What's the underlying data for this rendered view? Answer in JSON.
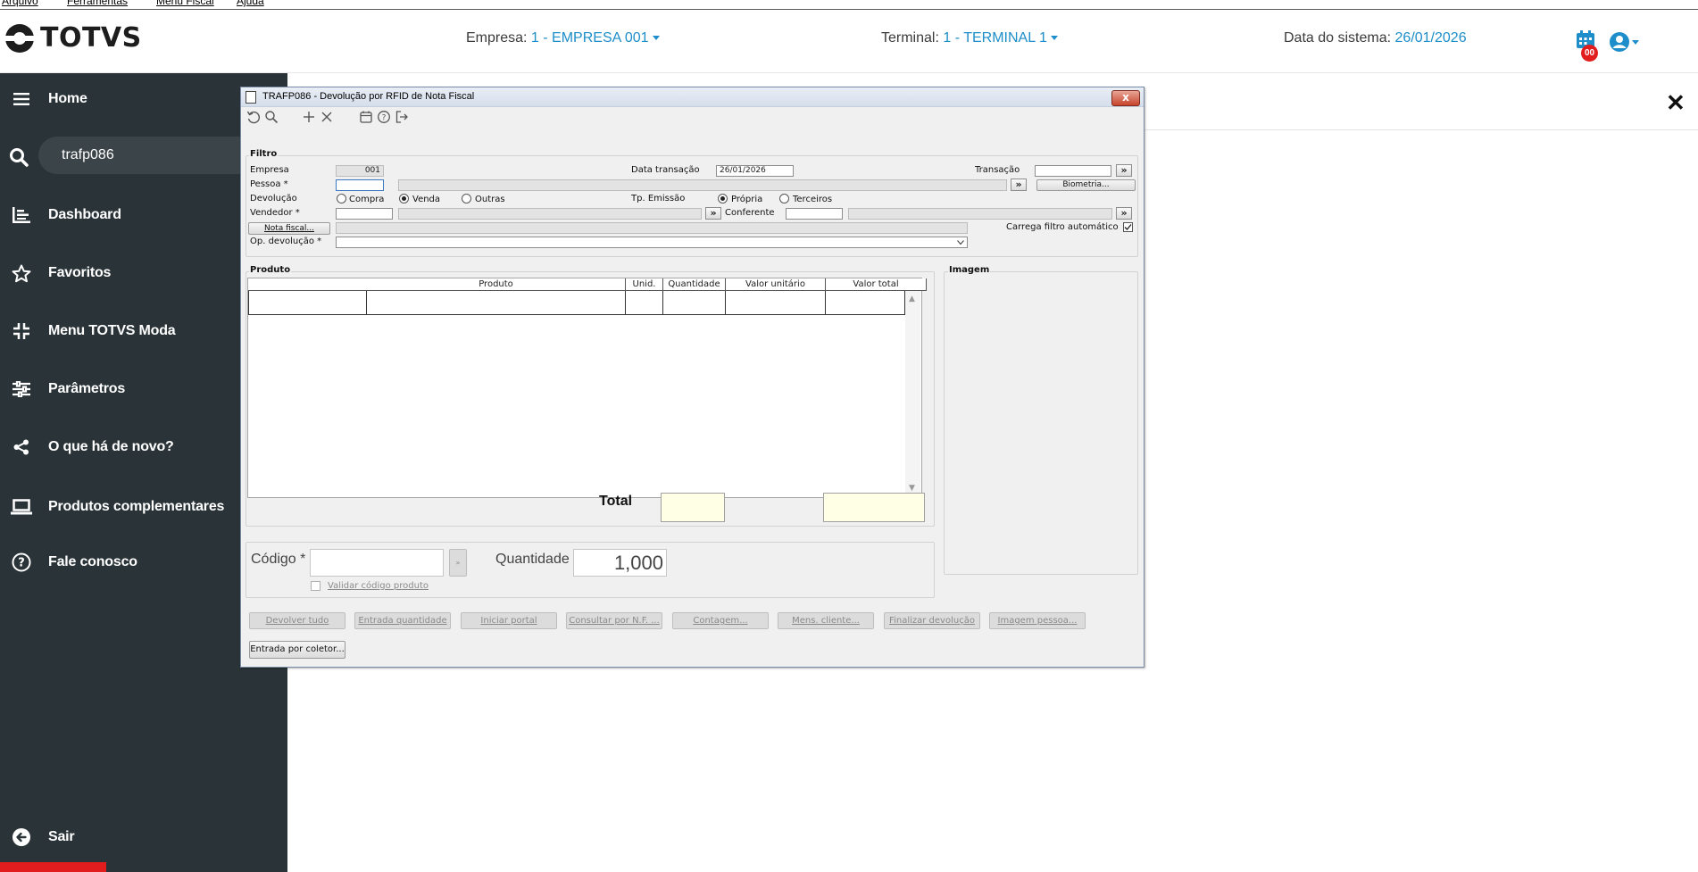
{
  "menubar": [
    "Arquivo",
    "Ferramentas",
    "Menu Fiscal",
    "Ajuda"
  ],
  "header": {
    "logo_text": "TOTVS",
    "empresa_label": "Empresa:",
    "empresa_value": "1 - EMPRESA 001",
    "terminal_label": "Terminal:",
    "terminal_value": "1 - TERMINAL 1",
    "data_label": "Data do sistema:",
    "data_value": "26/01/2026",
    "badge_count": "00",
    "accent": "#1d8ec9"
  },
  "sidebar": {
    "search_value": "trafp086",
    "items": [
      {
        "label": "Home",
        "icon": "menu-icon"
      },
      {
        "label": "Dashboard",
        "icon": "dashboard-icon"
      },
      {
        "label": "Favoritos",
        "icon": "star-icon"
      },
      {
        "label": "Menu TOTVS Moda",
        "icon": "collapse-icon"
      },
      {
        "label": "Parâmetros",
        "icon": "sliders-icon"
      },
      {
        "label": "O que há de novo?",
        "icon": "share-icon"
      },
      {
        "label": "Produtos complementares",
        "icon": "laptop-icon"
      },
      {
        "label": "Fale conosco",
        "icon": "help-icon"
      },
      {
        "label": "Sair",
        "icon": "logout-icon"
      }
    ]
  },
  "dialog": {
    "title": "TRAFP086 - Devolução por RFID de Nota Fiscal",
    "close_label": "x",
    "filtro": {
      "title": "Filtro",
      "empresa_label": "Empresa",
      "empresa_value": "001",
      "data_transacao_label": "Data transação",
      "data_transacao_value": "26/01/2026",
      "transacao_label": "Transação",
      "pessoa_label": "Pessoa *",
      "biometria_label": "Biometria...",
      "devolucao_label": "Devolução",
      "devolucao_options": [
        "Compra",
        "Venda",
        "Outras"
      ],
      "devolucao_selected": "Venda",
      "tp_emissao_label": "Tp. Emissão",
      "tp_emissao_options": [
        "Própria",
        "Terceiros"
      ],
      "tp_emissao_selected": "Própria",
      "vendedor_label": "Vendedor *",
      "conferente_label": "Conferente",
      "nota_fiscal_label": "Nota fiscal...",
      "carrega_filtro_label": "Carrega filtro automático",
      "carrega_filtro_checked": true,
      "op_devolucao_label": "Op. devolução *"
    },
    "produto": {
      "title": "Produto",
      "columns": [
        "Produto",
        "Unid.",
        "Quantidade",
        "Valor unitário",
        "Valor total"
      ],
      "total_label": "Total"
    },
    "imagem_title": "Imagem",
    "codigo_label": "Código *",
    "quantidade_label": "Quantidade",
    "quantidade_value": "1,000",
    "validar_label": "Validar código produto",
    "buttons": [
      "Devolver tudo",
      "Entrada quantidade",
      "Iniciar portal",
      "Consultar por N.F. ...",
      "Contagem...",
      "Mens. cliente...",
      "Finalizar devolução",
      "Imagem pessoa..."
    ],
    "entrada_coletor_label": "Entrada por coletor..."
  }
}
